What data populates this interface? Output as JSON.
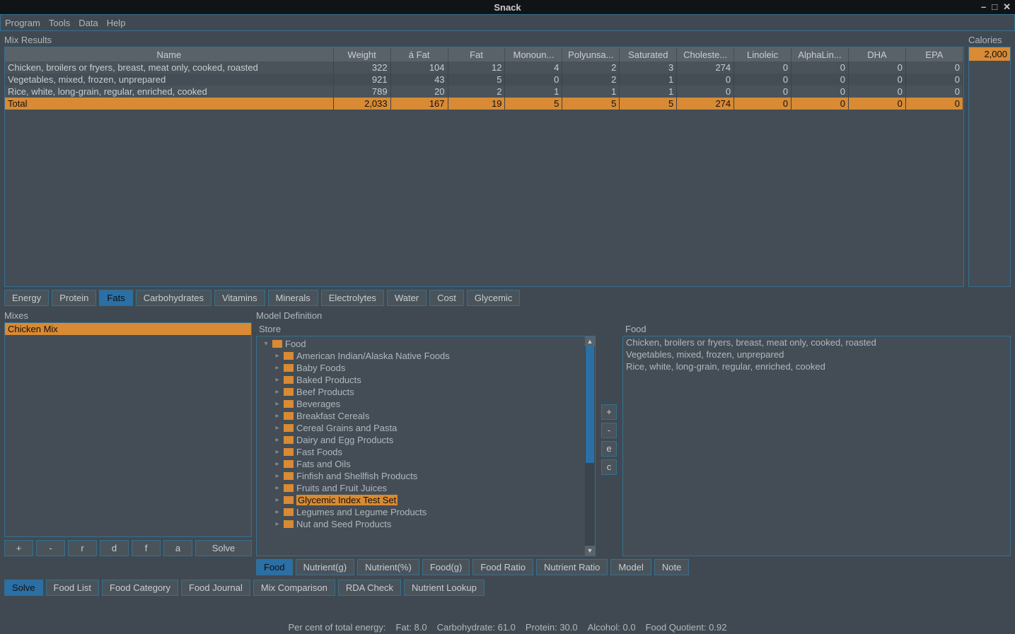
{
  "window": {
    "title": "Snack"
  },
  "menu": {
    "program": "Program",
    "tools": "Tools",
    "data": "Data",
    "help": "Help"
  },
  "mixResults": {
    "label": "Mix Results",
    "columns": [
      "Name",
      "Weight",
      "á Fat",
      "Fat",
      "Monoun...",
      "Polyunsa...",
      "Saturated",
      "Choleste...",
      "Linoleic",
      "AlphaLin...",
      "DHA",
      "EPA"
    ],
    "rows": [
      {
        "name": "Chicken, broilers or fryers, breast, meat only, cooked, roasted",
        "vals": [
          "322",
          "104",
          "12",
          "4",
          "2",
          "3",
          "274",
          "0",
          "0",
          "0",
          "0"
        ]
      },
      {
        "name": "Vegetables, mixed, frozen, unprepared",
        "vals": [
          "921",
          "43",
          "5",
          "0",
          "2",
          "1",
          "0",
          "0",
          "0",
          "0",
          "0"
        ]
      },
      {
        "name": "Rice, white, long-grain, regular, enriched, cooked",
        "vals": [
          "789",
          "20",
          "2",
          "1",
          "1",
          "1",
          "0",
          "0",
          "0",
          "0",
          "0"
        ]
      }
    ],
    "total": {
      "name": "Total",
      "vals": [
        "2,033",
        "167",
        "19",
        "5",
        "5",
        "5",
        "274",
        "0",
        "0",
        "0",
        "0"
      ]
    }
  },
  "calories": {
    "label": "Calories",
    "value": "2,000"
  },
  "nutrientTabs": [
    "Energy",
    "Protein",
    "Fats",
    "Carbohydrates",
    "Vitamins",
    "Minerals",
    "Electrolytes",
    "Water",
    "Cost",
    "Glycemic"
  ],
  "nutrientTabActive": 2,
  "mixes": {
    "label": "Mixes",
    "items": [
      "Chicken Mix"
    ],
    "selected": 0,
    "buttons": [
      "+",
      "-",
      "r",
      "d",
      "f",
      "a",
      "Solve"
    ]
  },
  "modelDef": {
    "label": "Model Definition",
    "storeLabel": "Store",
    "tree": {
      "root": "Food",
      "children": [
        "American Indian/Alaska Native Foods",
        "Baby Foods",
        "Baked Products",
        "Beef Products",
        "Beverages",
        "Breakfast Cereals",
        "Cereal Grains and Pasta",
        "Dairy and Egg Products",
        "Fast Foods",
        "Fats and Oils",
        "Finfish and Shellfish Products",
        "Fruits and Fruit Juices",
        "Glycemic Index Test Set",
        "Legumes and Legume Products",
        "Nut and Seed Products"
      ],
      "selected": 12
    },
    "storeButtons": [
      "+",
      "-",
      "e",
      "c"
    ],
    "foodLabel": "Food",
    "foodItems": [
      "Chicken, broilers or fryers, breast, meat only, cooked, roasted",
      "Vegetables, mixed, frozen, unprepared",
      "Rice, white, long-grain, regular, enriched, cooked"
    ],
    "modelTabs": [
      "Food",
      "Nutrient(g)",
      "Nutrient(%)",
      "Food(g)",
      "Food Ratio",
      "Nutrient Ratio",
      "Model",
      "Note"
    ],
    "modelTabActive": 0
  },
  "bottomTabs": [
    "Solve",
    "Food List",
    "Food Category",
    "Food Journal",
    "Mix Comparison",
    "RDA Check",
    "Nutrient Lookup"
  ],
  "bottomTabActive": 0,
  "status": {
    "label": "Per cent of total energy:",
    "fat": "Fat: 8.0",
    "carb": "Carbohydrate: 61.0",
    "protein": "Protein: 30.0",
    "alcohol": "Alcohol: 0.0",
    "fq": "Food Quotient: 0.92"
  }
}
